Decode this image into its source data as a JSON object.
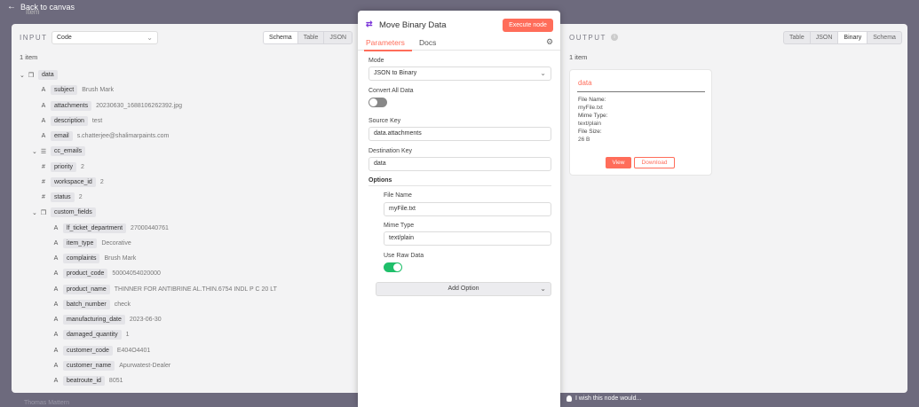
{
  "topbar": {
    "back_label": "Back to canvas",
    "bg_item": "Item"
  },
  "input": {
    "title": "INPUT",
    "select_value": "Code",
    "tabs": [
      "Schema",
      "Table",
      "JSON"
    ],
    "active_tab": "Schema",
    "count": "1 item",
    "rows": [
      {
        "indent": 0,
        "caret": "⌄",
        "type": "❒",
        "key": "data",
        "value": ""
      },
      {
        "indent": 1,
        "caret": "",
        "type": "A",
        "key": "subject",
        "value": "Brush Mark"
      },
      {
        "indent": 1,
        "caret": "",
        "type": "A",
        "key": "attachments",
        "value": "20230630_1688106262392.jpg"
      },
      {
        "indent": 1,
        "caret": "",
        "type": "A",
        "key": "description",
        "value": "test"
      },
      {
        "indent": 1,
        "caret": "",
        "type": "A",
        "key": "email",
        "value": "s.chatterjee@shalimarpaints.com"
      },
      {
        "indent": 1,
        "caret": "⌄",
        "type": "☰",
        "key": "cc_emails",
        "value": ""
      },
      {
        "indent": 1,
        "caret": "",
        "type": "#",
        "key": "priority",
        "value": "2"
      },
      {
        "indent": 1,
        "caret": "",
        "type": "#",
        "key": "workspace_id",
        "value": "2"
      },
      {
        "indent": 1,
        "caret": "",
        "type": "#",
        "key": "status",
        "value": "2"
      },
      {
        "indent": 1,
        "caret": "⌄",
        "type": "❒",
        "key": "custom_fields",
        "value": ""
      },
      {
        "indent": 2,
        "caret": "",
        "type": "A",
        "key": "lf_ticket_department",
        "value": "27000440761"
      },
      {
        "indent": 2,
        "caret": "",
        "type": "A",
        "key": "item_type",
        "value": "Decorative"
      },
      {
        "indent": 2,
        "caret": "",
        "type": "A",
        "key": "complaints",
        "value": "Brush Mark"
      },
      {
        "indent": 2,
        "caret": "",
        "type": "A",
        "key": "product_code",
        "value": "50004054020000"
      },
      {
        "indent": 2,
        "caret": "",
        "type": "A",
        "key": "product_name",
        "value": "THINNER FOR ANTIBRINE AL.THIN.6754 INDL P C 20 LT"
      },
      {
        "indent": 2,
        "caret": "",
        "type": "A",
        "key": "batch_number",
        "value": "check"
      },
      {
        "indent": 2,
        "caret": "",
        "type": "A",
        "key": "manufacturing_date",
        "value": "2023-06-30"
      },
      {
        "indent": 2,
        "caret": "",
        "type": "A",
        "key": "damaged_quantity",
        "value": "1"
      },
      {
        "indent": 2,
        "caret": "",
        "type": "A",
        "key": "customer_code",
        "value": "E404O4401"
      },
      {
        "indent": 2,
        "caret": "",
        "type": "A",
        "key": "customer_name",
        "value": "Apurwatest-Dealer"
      },
      {
        "indent": 2,
        "caret": "",
        "type": "A",
        "key": "beatroute_id",
        "value": "8051"
      }
    ]
  },
  "node": {
    "icon": "⇄",
    "title": "Move Binary Data",
    "execute_label": "Execute node",
    "tabs": {
      "parameters": "Parameters",
      "docs": "Docs"
    },
    "mode_label": "Mode",
    "mode_value": "JSON to Binary",
    "convert_all_label": "Convert All Data",
    "convert_all_on": false,
    "source_key_label": "Source Key",
    "source_key_value": "data.attachments",
    "dest_key_label": "Destination Key",
    "dest_key_value": "data",
    "options_title": "Options",
    "file_name_label": "File Name",
    "file_name_value": "myFile.txt",
    "mime_type_label": "Mime Type",
    "mime_type_value": "text/plain",
    "use_raw_label": "Use Raw Data",
    "use_raw_on": true,
    "add_option_label": "Add Option"
  },
  "output": {
    "title": "OUTPUT",
    "tabs": [
      "Table",
      "JSON",
      "Binary",
      "Schema"
    ],
    "active_tab": "Binary",
    "count": "1 item",
    "card": {
      "title": "data",
      "file_name_label": "File Name:",
      "file_name": "myFile.txt",
      "mime_label": "Mime Type:",
      "mime": "text/plain",
      "size_label": "File Size:",
      "size": "26 B",
      "view_label": "View",
      "download_label": "Download"
    }
  },
  "footer": {
    "wish_label": "I wish this node would...",
    "bg_text": "Thomas Mattern"
  },
  "colors": {
    "accent": "#ff6d5a",
    "toggle_on": "#1fbf6a",
    "canvas": "#6d6a7d"
  }
}
